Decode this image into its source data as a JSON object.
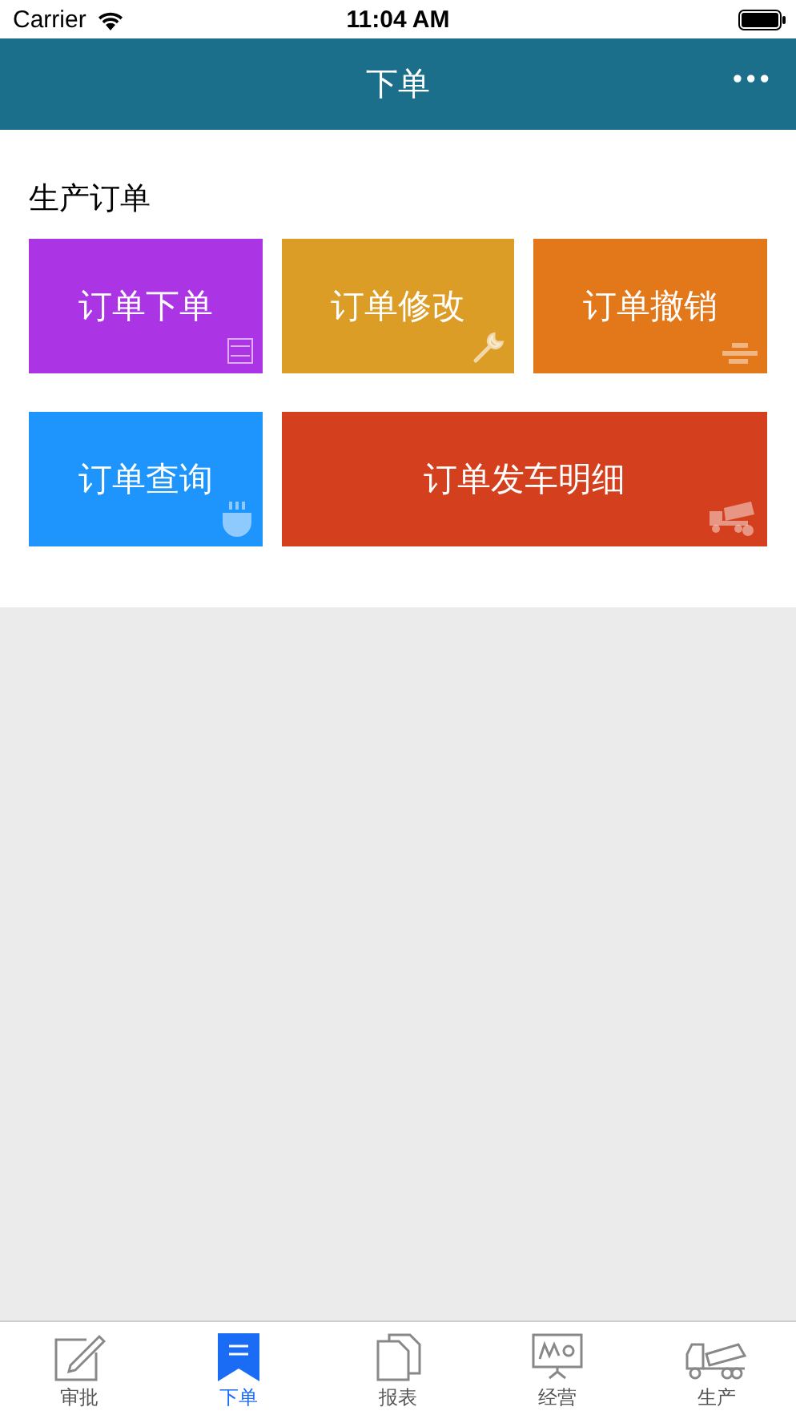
{
  "status_bar": {
    "carrier": "Carrier",
    "time": "11:04 AM"
  },
  "nav_bar": {
    "title": "下单",
    "menu": "•••"
  },
  "section": {
    "title": "生产订单",
    "tiles": [
      {
        "label": "订单下单",
        "color": "#ab35e4",
        "kind": "form"
      },
      {
        "label": "订单修改",
        "color": "#dc9d27",
        "kind": "wrench"
      },
      {
        "label": "订单撤销",
        "color": "#e3781a",
        "kind": "bricks"
      },
      {
        "label": "订单查询",
        "color": "#1e95fc",
        "kind": "cup"
      },
      {
        "label": "订单发车明细",
        "color": "#d4401e",
        "kind": "truck"
      }
    ]
  },
  "tab_bar": [
    {
      "label": "审批",
      "kind": "edit",
      "selected": false
    },
    {
      "label": "下单",
      "kind": "bookmark",
      "selected": true
    },
    {
      "label": "报表",
      "kind": "pages",
      "selected": false
    },
    {
      "label": "经营",
      "kind": "chart",
      "selected": false
    },
    {
      "label": "生产",
      "kind": "truck",
      "selected": false
    }
  ]
}
